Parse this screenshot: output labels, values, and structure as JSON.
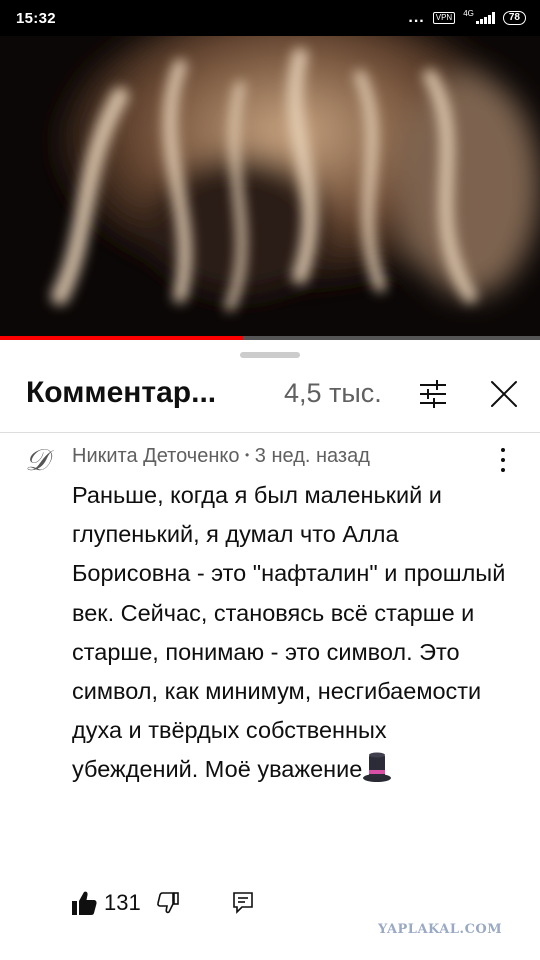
{
  "status_bar": {
    "time": "15:32",
    "dots": "...",
    "vpn": "VPN",
    "network": "4G",
    "battery": "78"
  },
  "video": {
    "progress_fraction": 0.45
  },
  "comments_panel": {
    "title": "Комментар...",
    "count": "4,5 тыс.",
    "filter_icon": "sort-filter-icon",
    "close_icon": "close-icon"
  },
  "comment": {
    "avatar_letter": "𝒟",
    "author": "Никита Деточенко",
    "separator": "•",
    "time_ago": "3 нед. назад",
    "text": "Раньше, когда я был маленький и глупенький, я думал что Алла Борисовна - это \"нафталин\" и прошлый век. Сейчас, становясь всё старше и старше, понимаю - это символ. Это символ, как минимум, несгибаемости духа и твёрдых собственных убеждений. Моё уважение",
    "emoji_icon": "top-hat-icon",
    "likes": "131",
    "like_icon": "thumbs-up-icon",
    "dislike_icon": "thumbs-down-icon",
    "reply_icon": "reply-comment-icon"
  },
  "watermark": "YAPLAKAL.COM",
  "colors": {
    "progress": "#ff0000",
    "text_primary": "#0f0f0f",
    "text_secondary": "#606060",
    "watermark": "#9aa9c4"
  }
}
